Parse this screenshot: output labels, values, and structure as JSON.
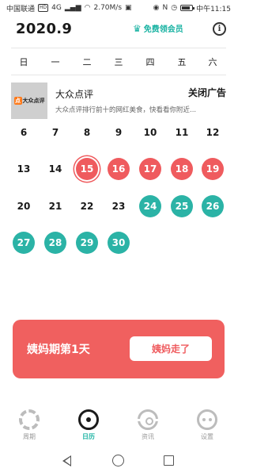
{
  "status_bar": {
    "carrier": "中国联通",
    "hd": "HD",
    "signal": "4G",
    "speed": "2.70M/s",
    "time": "中午11:15",
    "battery_level": 0.8
  },
  "header": {
    "title": "2020.9",
    "vip_label": "免费领会员",
    "info_glyph": "i"
  },
  "weekdays": [
    "日",
    "一",
    "二",
    "三",
    "四",
    "五",
    "六"
  ],
  "ad": {
    "logo_text": "大众点评",
    "logo_mark": "点",
    "title": "大众点评",
    "close_label": "关闭广告",
    "description": "大众点评排行前十的网红美食，快看看你附近..."
  },
  "calendar": {
    "rows": [
      [
        {
          "day": "6",
          "type": "normal"
        },
        {
          "day": "7",
          "type": "normal"
        },
        {
          "day": "8",
          "type": "normal"
        },
        {
          "day": "9",
          "type": "normal"
        },
        {
          "day": "10",
          "type": "normal"
        },
        {
          "day": "11",
          "type": "normal"
        },
        {
          "day": "12",
          "type": "normal"
        }
      ],
      [
        {
          "day": "13",
          "type": "normal"
        },
        {
          "day": "14",
          "type": "normal"
        },
        {
          "day": "15",
          "type": "today"
        },
        {
          "day": "16",
          "type": "period"
        },
        {
          "day": "17",
          "type": "period"
        },
        {
          "day": "18",
          "type": "period"
        },
        {
          "day": "19",
          "type": "period"
        }
      ],
      [
        {
          "day": "20",
          "type": "normal"
        },
        {
          "day": "21",
          "type": "normal"
        },
        {
          "day": "22",
          "type": "normal"
        },
        {
          "day": "23",
          "type": "normal"
        },
        {
          "day": "24",
          "type": "fertile"
        },
        {
          "day": "25",
          "type": "fertile"
        },
        {
          "day": "26",
          "type": "fertile"
        }
      ],
      [
        {
          "day": "27",
          "type": "fertile"
        },
        {
          "day": "28",
          "type": "fertile"
        },
        {
          "day": "29",
          "type": "fertile"
        },
        {
          "day": "30",
          "type": "fertile"
        }
      ]
    ]
  },
  "status_card": {
    "label": "姨妈期第1天",
    "button_label": "姨妈走了"
  },
  "bottom_nav": [
    {
      "label": "周期",
      "icon": "cycle-icon",
      "active": false
    },
    {
      "label": "日历",
      "icon": "calendar-icon",
      "active": true
    },
    {
      "label": "资讯",
      "icon": "news-icon",
      "active": false
    },
    {
      "label": "设置",
      "icon": "settings-icon",
      "active": false
    }
  ],
  "colors": {
    "period": "#ef5b5e",
    "fertile": "#2bb3a6",
    "accent": "#1bb3a3",
    "card": "#f0605f"
  }
}
